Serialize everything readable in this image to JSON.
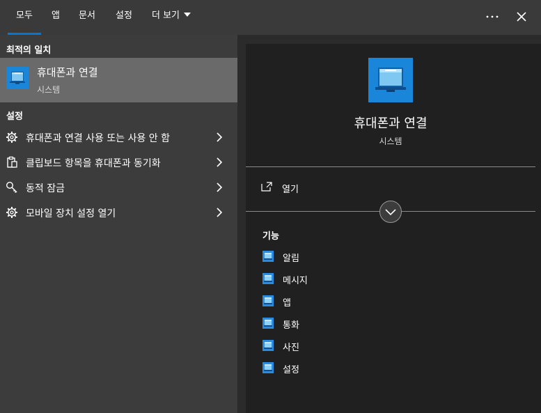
{
  "tabs": [
    {
      "label": "모두"
    },
    {
      "label": "앱"
    },
    {
      "label": "문서"
    },
    {
      "label": "설정"
    },
    {
      "label": "더 보기"
    }
  ],
  "toolbar": {
    "more_icon": "ellipsis-icon",
    "close_icon": "close-icon"
  },
  "best_match": {
    "section_title": "최적의 일치",
    "name": "휴대폰과 연결",
    "type": "시스템",
    "icon": "phone-link-app-icon"
  },
  "settings": {
    "section_title": "설정",
    "items": [
      {
        "label": "휴대폰과 연결 사용 또는 사용 안 함",
        "icon": "gear-icon"
      },
      {
        "label": "클립보드 항목을 휴대폰과 동기화",
        "icon": "clipboard-icon"
      },
      {
        "label": "동적 잠금",
        "icon": "key-icon"
      },
      {
        "label": "모바일 장치 설정 열기",
        "icon": "gear-icon"
      }
    ]
  },
  "detail": {
    "name": "휴대폰과 연결",
    "type": "시스템",
    "open_label": "열기",
    "features_title": "기능",
    "features": [
      {
        "label": "알림"
      },
      {
        "label": "메시지"
      },
      {
        "label": "앱"
      },
      {
        "label": "통화"
      },
      {
        "label": "사진"
      },
      {
        "label": "설정"
      }
    ]
  },
  "colors": {
    "accent": "#0078d7",
    "selected_row": "#6a6a6a",
    "left_panel": "#3c3c3c",
    "detail_panel": "#202020"
  }
}
